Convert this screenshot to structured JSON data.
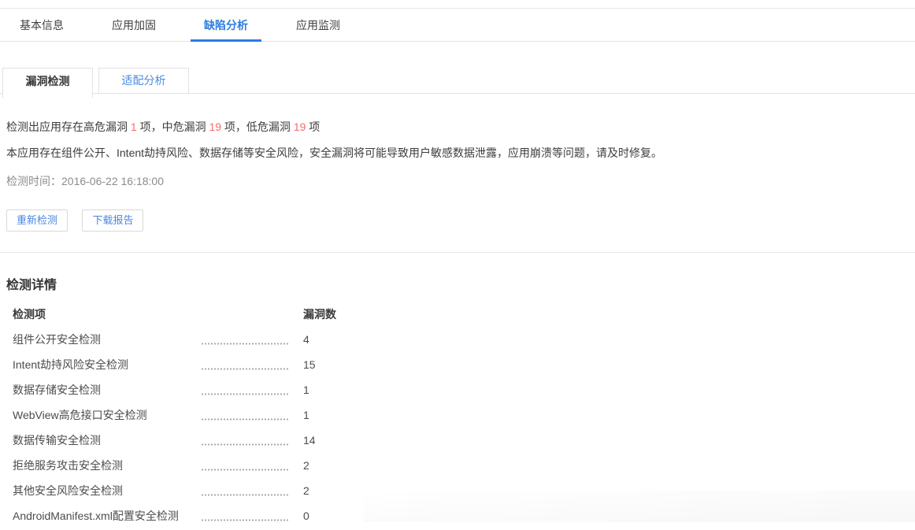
{
  "top_tabs": [
    {
      "label": "基本信息",
      "active": false
    },
    {
      "label": "应用加固",
      "active": false
    },
    {
      "label": "缺陷分析",
      "active": true
    },
    {
      "label": "应用监测",
      "active": false
    }
  ],
  "sub_tabs": [
    {
      "label": "漏洞检测",
      "active": true
    },
    {
      "label": "适配分析",
      "active": false
    }
  ],
  "summary": {
    "line1": [
      {
        "text": "检测出应用存在高危漏洞 "
      },
      {
        "text": "1"
      },
      {
        "text": " 项，中危漏洞 "
      },
      {
        "text": "19"
      },
      {
        "text": " 项，低危漏洞 "
      },
      {
        "text": "19"
      },
      {
        "text": " 项"
      }
    ],
    "line2": "本应用存在组件公开、Intent劫持风险、数据存储等安全风险，安全漏洞将可能导致用户敏感数据泄露，应用崩溃等问题，请及时修复。",
    "time_label": "检测时间：",
    "time_value": "2016-06-22 16:18:00"
  },
  "actions": {
    "recheck_label": "重新检测",
    "download_label": "下载报告"
  },
  "details": {
    "title": "检测详情",
    "col_item": "检测项",
    "col_count": "漏洞数",
    "rows": [
      {
        "name": "组件公开安全检测",
        "count": "4"
      },
      {
        "name": "Intent劫持风险安全检测",
        "count": "15"
      },
      {
        "name": "数据存储安全检测",
        "count": "1"
      },
      {
        "name": "WebView高危接口安全检测",
        "count": "1"
      },
      {
        "name": "数据传输安全检测",
        "count": "14"
      },
      {
        "name": "拒绝服务攻击安全检测",
        "count": "2"
      },
      {
        "name": "其他安全风险安全检测",
        "count": "2"
      },
      {
        "name": "AndroidManifest.xml配置安全检测",
        "count": "0"
      }
    ]
  },
  "colors": {
    "accent_blue": "#2b7ce0",
    "link_blue": "#4a8be2",
    "alert_red": "#f76b6b"
  }
}
